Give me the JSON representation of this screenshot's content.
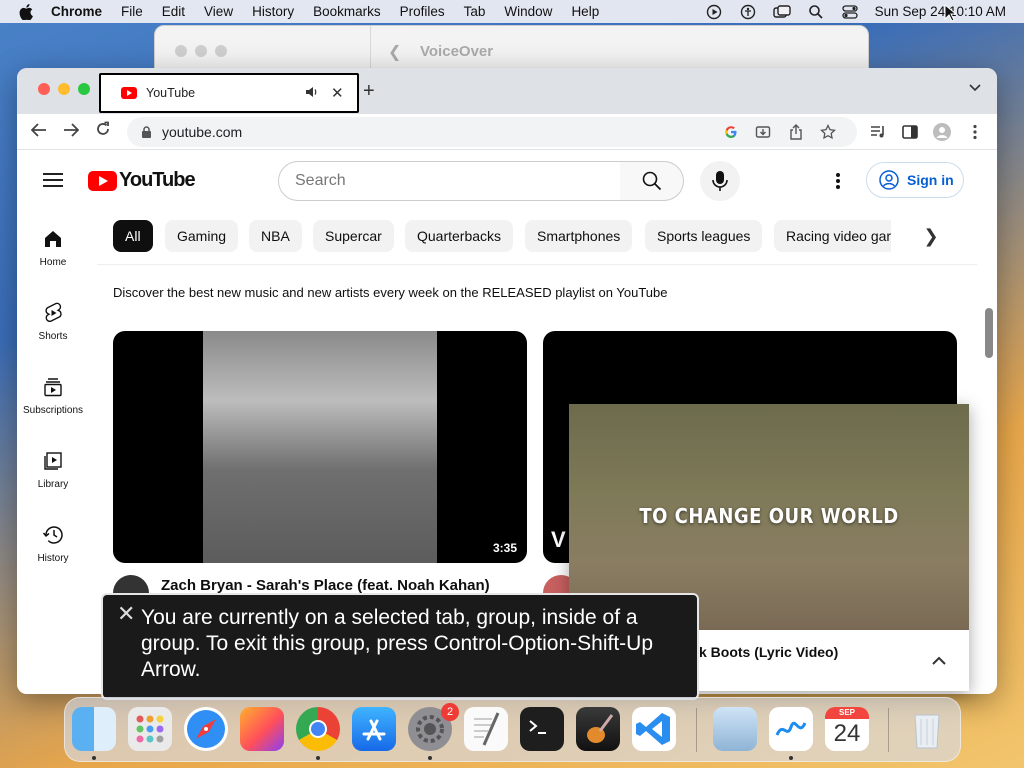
{
  "menubar": {
    "app": "Chrome",
    "items": [
      "File",
      "Edit",
      "View",
      "History",
      "Bookmarks",
      "Profiles",
      "Tab",
      "Window",
      "Help"
    ],
    "clock": "Sun Sep 24  10:10 AM"
  },
  "voiceover_window": {
    "title": "VoiceOver"
  },
  "browser": {
    "tab": {
      "title": "YouTube"
    },
    "url": "youtube.com"
  },
  "youtube": {
    "logo_text": "YouTube",
    "search_placeholder": "Search",
    "signin_label": "Sign in",
    "sidebar": [
      {
        "label": "Home",
        "icon": "home-icon"
      },
      {
        "label": "Shorts",
        "icon": "shorts-icon"
      },
      {
        "label": "Subscriptions",
        "icon": "subscriptions-icon"
      },
      {
        "label": "Library",
        "icon": "library-icon"
      },
      {
        "label": "History",
        "icon": "history-icon"
      }
    ],
    "chips": [
      "All",
      "Gaming",
      "NBA",
      "Supercar",
      "Quarterbacks",
      "Smartphones",
      "Sports leagues",
      "Racing video gar"
    ],
    "description": "Discover the best new music and new artists every week on the RELEASED playlist on YouTube",
    "video1": {
      "title": "Zach Bryan - Sarah's Place (feat. Noah Kahan)",
      "duration": "3:35"
    },
    "video2": {
      "thumb_letter": "V"
    },
    "pip": {
      "caption": "TO CHANGE OUR WORLD",
      "title": "ork Boots (Lyric Video)"
    }
  },
  "voiceover_caption": {
    "message": "You are currently on a selected tab, group, inside of a group.  To exit this group, press Control-Option-Shift-Up Arrow."
  },
  "dock": {
    "settings_badge": "2",
    "calendar_month": "SEP",
    "calendar_day": "24"
  },
  "colors": {
    "youtube_red": "#ff0000",
    "signin_blue": "#065fd4",
    "chip_active": "#0f0f0f"
  }
}
